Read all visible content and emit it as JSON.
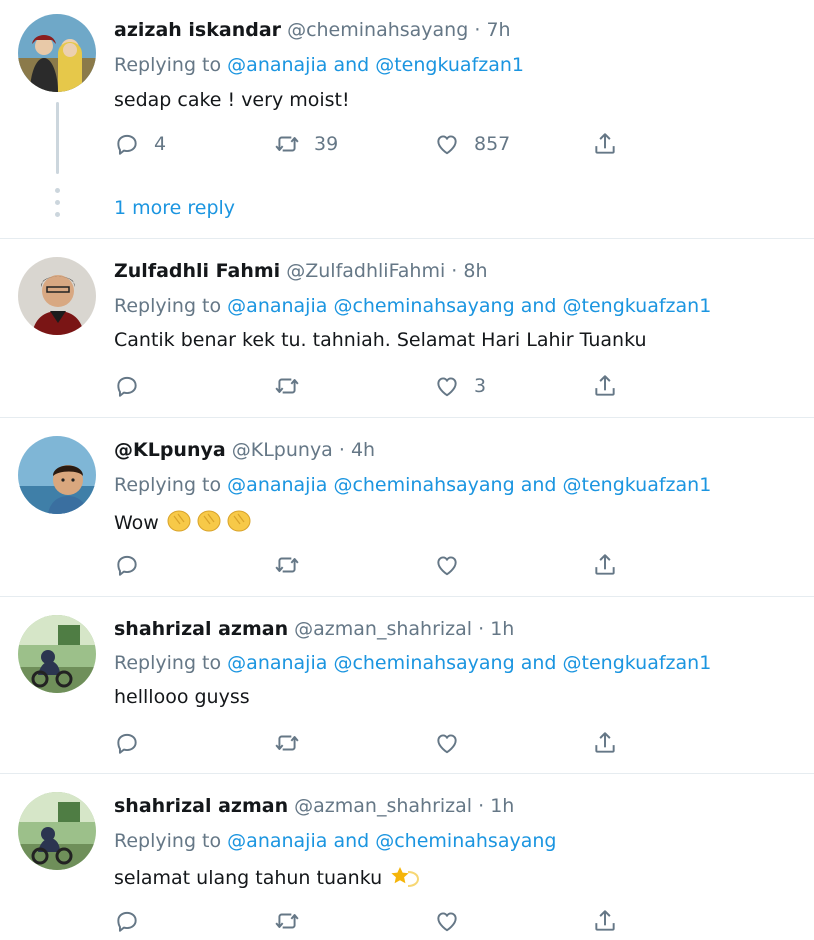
{
  "colors": {
    "link": "#1b95e0",
    "muted": "#657786",
    "text": "#14171a",
    "divider": "#e6ecf0",
    "thread_line": "#ccd6dd"
  },
  "icons": {
    "reply": "reply-icon",
    "retweet": "retweet-icon",
    "like": "like-icon",
    "share": "share-icon"
  },
  "tweets": [
    {
      "name": "azizah iskandar",
      "handle": "@cheminahsayang",
      "sep": "·",
      "time": "7h",
      "reply_prefix": "Replying to",
      "mentions": [
        "@ananajia",
        "and",
        "@tengkuafzan1"
      ],
      "text": "sedap cake ! very moist!",
      "counts": {
        "reply": "4",
        "retweet": "39",
        "like": "857"
      },
      "more_replies": "1 more reply"
    },
    {
      "name": "Zulfadhli Fahmi",
      "handle": "@ZulfadhliFahmi",
      "sep": "·",
      "time": "8h",
      "reply_prefix": "Replying to",
      "mentions": [
        "@ananajia",
        "@cheminahsayang",
        "and",
        "@tengkuafzan1"
      ],
      "text": "Cantik benar kek tu. tahniah. Selamat Hari Lahir Tuanku",
      "counts": {
        "reply": "",
        "retweet": "",
        "like": "3"
      }
    },
    {
      "name": "@KLpunya",
      "handle": "@KLpunya",
      "sep": "·",
      "time": "4h",
      "reply_prefix": "Replying to",
      "mentions": [
        "@ananajia",
        "@cheminahsayang",
        "and",
        "@tengkuafzan1"
      ],
      "text": "Wow",
      "counts": {
        "reply": "",
        "retweet": "",
        "like": ""
      }
    },
    {
      "name": "shahrizal azman",
      "handle": "@azman_shahrizal",
      "sep": "·",
      "time": "1h",
      "reply_prefix": "Replying to",
      "mentions": [
        "@ananajia",
        "@cheminahsayang",
        "and",
        "@tengkuafzan1"
      ],
      "text": "helllooo guyss",
      "counts": {
        "reply": "",
        "retweet": "",
        "like": ""
      }
    },
    {
      "name": "shahrizal azman",
      "handle": "@azman_shahrizal",
      "sep": "·",
      "time": "1h",
      "reply_prefix": "Replying to",
      "mentions": [
        "@ananajia",
        "and",
        "@cheminahsayang"
      ],
      "text": "selamat ulang tahun tuanku",
      "counts": {
        "reply": "",
        "retweet": "",
        "like": ""
      }
    }
  ]
}
